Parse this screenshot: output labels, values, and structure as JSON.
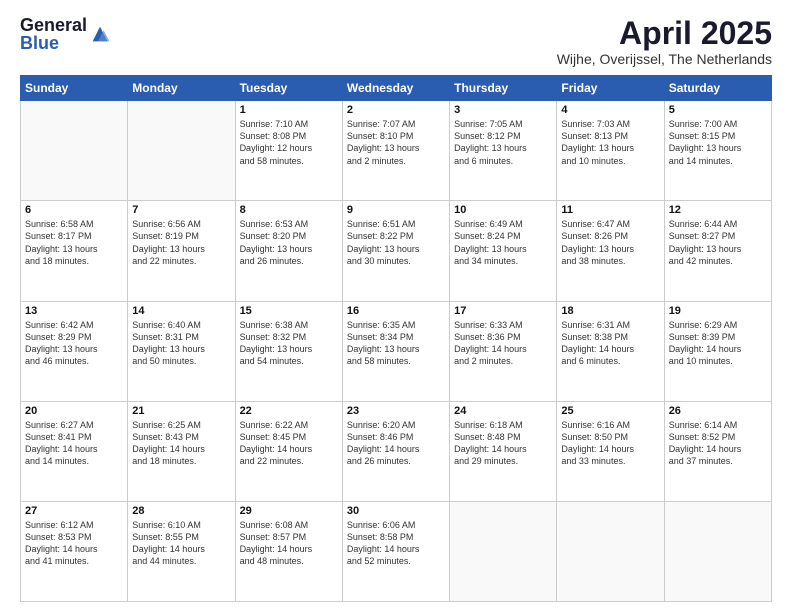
{
  "logo": {
    "general": "General",
    "blue": "Blue"
  },
  "title": {
    "month": "April 2025",
    "location": "Wijhe, Overijssel, The Netherlands"
  },
  "weekdays": [
    "Sunday",
    "Monday",
    "Tuesday",
    "Wednesday",
    "Thursday",
    "Friday",
    "Saturday"
  ],
  "weeks": [
    [
      {
        "day": "",
        "info": ""
      },
      {
        "day": "",
        "info": ""
      },
      {
        "day": "1",
        "info": "Sunrise: 7:10 AM\nSunset: 8:08 PM\nDaylight: 12 hours\nand 58 minutes."
      },
      {
        "day": "2",
        "info": "Sunrise: 7:07 AM\nSunset: 8:10 PM\nDaylight: 13 hours\nand 2 minutes."
      },
      {
        "day": "3",
        "info": "Sunrise: 7:05 AM\nSunset: 8:12 PM\nDaylight: 13 hours\nand 6 minutes."
      },
      {
        "day": "4",
        "info": "Sunrise: 7:03 AM\nSunset: 8:13 PM\nDaylight: 13 hours\nand 10 minutes."
      },
      {
        "day": "5",
        "info": "Sunrise: 7:00 AM\nSunset: 8:15 PM\nDaylight: 13 hours\nand 14 minutes."
      }
    ],
    [
      {
        "day": "6",
        "info": "Sunrise: 6:58 AM\nSunset: 8:17 PM\nDaylight: 13 hours\nand 18 minutes."
      },
      {
        "day": "7",
        "info": "Sunrise: 6:56 AM\nSunset: 8:19 PM\nDaylight: 13 hours\nand 22 minutes."
      },
      {
        "day": "8",
        "info": "Sunrise: 6:53 AM\nSunset: 8:20 PM\nDaylight: 13 hours\nand 26 minutes."
      },
      {
        "day": "9",
        "info": "Sunrise: 6:51 AM\nSunset: 8:22 PM\nDaylight: 13 hours\nand 30 minutes."
      },
      {
        "day": "10",
        "info": "Sunrise: 6:49 AM\nSunset: 8:24 PM\nDaylight: 13 hours\nand 34 minutes."
      },
      {
        "day": "11",
        "info": "Sunrise: 6:47 AM\nSunset: 8:26 PM\nDaylight: 13 hours\nand 38 minutes."
      },
      {
        "day": "12",
        "info": "Sunrise: 6:44 AM\nSunset: 8:27 PM\nDaylight: 13 hours\nand 42 minutes."
      }
    ],
    [
      {
        "day": "13",
        "info": "Sunrise: 6:42 AM\nSunset: 8:29 PM\nDaylight: 13 hours\nand 46 minutes."
      },
      {
        "day": "14",
        "info": "Sunrise: 6:40 AM\nSunset: 8:31 PM\nDaylight: 13 hours\nand 50 minutes."
      },
      {
        "day": "15",
        "info": "Sunrise: 6:38 AM\nSunset: 8:32 PM\nDaylight: 13 hours\nand 54 minutes."
      },
      {
        "day": "16",
        "info": "Sunrise: 6:35 AM\nSunset: 8:34 PM\nDaylight: 13 hours\nand 58 minutes."
      },
      {
        "day": "17",
        "info": "Sunrise: 6:33 AM\nSunset: 8:36 PM\nDaylight: 14 hours\nand 2 minutes."
      },
      {
        "day": "18",
        "info": "Sunrise: 6:31 AM\nSunset: 8:38 PM\nDaylight: 14 hours\nand 6 minutes."
      },
      {
        "day": "19",
        "info": "Sunrise: 6:29 AM\nSunset: 8:39 PM\nDaylight: 14 hours\nand 10 minutes."
      }
    ],
    [
      {
        "day": "20",
        "info": "Sunrise: 6:27 AM\nSunset: 8:41 PM\nDaylight: 14 hours\nand 14 minutes."
      },
      {
        "day": "21",
        "info": "Sunrise: 6:25 AM\nSunset: 8:43 PM\nDaylight: 14 hours\nand 18 minutes."
      },
      {
        "day": "22",
        "info": "Sunrise: 6:22 AM\nSunset: 8:45 PM\nDaylight: 14 hours\nand 22 minutes."
      },
      {
        "day": "23",
        "info": "Sunrise: 6:20 AM\nSunset: 8:46 PM\nDaylight: 14 hours\nand 26 minutes."
      },
      {
        "day": "24",
        "info": "Sunrise: 6:18 AM\nSunset: 8:48 PM\nDaylight: 14 hours\nand 29 minutes."
      },
      {
        "day": "25",
        "info": "Sunrise: 6:16 AM\nSunset: 8:50 PM\nDaylight: 14 hours\nand 33 minutes."
      },
      {
        "day": "26",
        "info": "Sunrise: 6:14 AM\nSunset: 8:52 PM\nDaylight: 14 hours\nand 37 minutes."
      }
    ],
    [
      {
        "day": "27",
        "info": "Sunrise: 6:12 AM\nSunset: 8:53 PM\nDaylight: 14 hours\nand 41 minutes."
      },
      {
        "day": "28",
        "info": "Sunrise: 6:10 AM\nSunset: 8:55 PM\nDaylight: 14 hours\nand 44 minutes."
      },
      {
        "day": "29",
        "info": "Sunrise: 6:08 AM\nSunset: 8:57 PM\nDaylight: 14 hours\nand 48 minutes."
      },
      {
        "day": "30",
        "info": "Sunrise: 6:06 AM\nSunset: 8:58 PM\nDaylight: 14 hours\nand 52 minutes."
      },
      {
        "day": "",
        "info": ""
      },
      {
        "day": "",
        "info": ""
      },
      {
        "day": "",
        "info": ""
      }
    ]
  ]
}
